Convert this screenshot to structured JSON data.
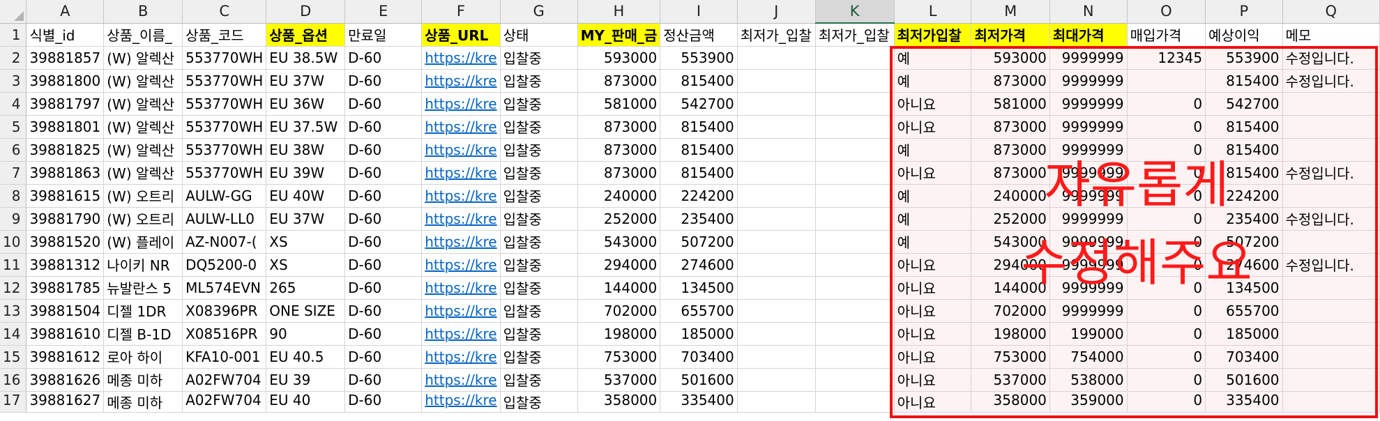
{
  "sheet": {
    "columns": [
      "A",
      "B",
      "C",
      "D",
      "E",
      "F",
      "G",
      "H",
      "I",
      "J",
      "K",
      "L",
      "M",
      "N",
      "O",
      "P",
      "Q"
    ],
    "selected_column": "K",
    "row_numbers": [
      1,
      2,
      3,
      4,
      5,
      6,
      7,
      8,
      9,
      10,
      11,
      12,
      13,
      14,
      15,
      16,
      17
    ],
    "header_row": [
      "식별_id",
      "상품_이름_",
      "상품_코드",
      "상품_옵션",
      "만료일",
      "상품_URL",
      "상태",
      "MY_판매_금",
      "정산금액",
      "최저가_입찰",
      "최저가_입찰",
      "최저가입찰",
      "최저가격",
      "최대가격",
      "매입가격",
      "예상이익",
      "메모"
    ],
    "highlighted_headers": [
      "D",
      "F",
      "H",
      "L",
      "M",
      "N"
    ],
    "rows": [
      [
        "39881857",
        "(W) 알렉산",
        "553770WH",
        "EU 38.5W",
        "D-60",
        "https://kre",
        "입찰중",
        "593000",
        "553900",
        "",
        "",
        "예",
        "593000",
        "9999999",
        "12345",
        "553900",
        "수정입니다."
      ],
      [
        "39881800",
        "(W) 알렉산",
        "553770WH",
        "EU 37W",
        "D-60",
        "https://kre",
        "입찰중",
        "873000",
        "815400",
        "",
        "",
        "예",
        "873000",
        "9999999",
        "",
        "815400",
        "수정입니다."
      ],
      [
        "39881797",
        "(W) 알렉산",
        "553770WH",
        "EU 36W",
        "D-60",
        "https://kre",
        "입찰중",
        "581000",
        "542700",
        "",
        "",
        "아니요",
        "581000",
        "9999999",
        "0",
        "542700",
        ""
      ],
      [
        "39881801",
        "(W) 알렉산",
        "553770WH",
        "EU 37.5W",
        "D-60",
        "https://kre",
        "입찰중",
        "873000",
        "815400",
        "",
        "",
        "아니요",
        "873000",
        "9999999",
        "0",
        "815400",
        ""
      ],
      [
        "39881825",
        "(W) 알렉산",
        "553770WH",
        "EU 38W",
        "D-60",
        "https://kre",
        "입찰중",
        "873000",
        "815400",
        "",
        "",
        "예",
        "873000",
        "9999999",
        "0",
        "815400",
        ""
      ],
      [
        "39881863",
        "(W) 알렉산",
        "553770WH",
        "EU 39W",
        "D-60",
        "https://kre",
        "입찰중",
        "873000",
        "815400",
        "",
        "",
        "아니요",
        "873000",
        "9999999",
        "0",
        "815400",
        "수정입니다."
      ],
      [
        "39881615",
        "(W) 오트리",
        "AULW-GG",
        "EU 40W",
        "D-60",
        "https://kre",
        "입찰중",
        "240000",
        "224200",
        "",
        "",
        "예",
        "240000",
        "9999999",
        "0",
        "224200",
        ""
      ],
      [
        "39881790",
        "(W) 오트리",
        "AULW-LL0",
        "EU 37W",
        "D-60",
        "https://kre",
        "입찰중",
        "252000",
        "235400",
        "",
        "",
        "예",
        "252000",
        "9999999",
        "0",
        "235400",
        "수정입니다."
      ],
      [
        "39881520",
        "(W) 플레이",
        "AZ-N007-(",
        "XS",
        "D-60",
        "https://kre",
        "입찰중",
        "543000",
        "507200",
        "",
        "",
        "예",
        "543000",
        "9999999",
        "0",
        "507200",
        ""
      ],
      [
        "39881312",
        "나이키 NR",
        "DQ5200-0",
        "XS",
        "D-60",
        "https://kre",
        "입찰중",
        "294000",
        "274600",
        "",
        "",
        "아니요",
        "294000",
        "9999999",
        "0",
        "274600",
        "수정입니다."
      ],
      [
        "39881785",
        "뉴발란스 5",
        "ML574EVN",
        "265",
        "D-60",
        "https://kre",
        "입찰중",
        "144000",
        "134500",
        "",
        "",
        "아니요",
        "144000",
        "9999999",
        "0",
        "134500",
        ""
      ],
      [
        "39881504",
        "디젤 1DR",
        "X08396PR",
        "ONE SIZE",
        "D-60",
        "https://kre",
        "입찰중",
        "702000",
        "655700",
        "",
        "",
        "아니요",
        "702000",
        "9999999",
        "0",
        "655700",
        ""
      ],
      [
        "39881610",
        "디젤 B-1D",
        "X08516PR",
        "90",
        "D-60",
        "https://kre",
        "입찰중",
        "198000",
        "185000",
        "",
        "",
        "아니요",
        "198000",
        "199000",
        "0",
        "185000",
        ""
      ],
      [
        "39881612",
        "로아 하이",
        "KFA10-001",
        "EU 40.5",
        "D-60",
        "https://kre",
        "입찰중",
        "753000",
        "703400",
        "",
        "",
        "아니요",
        "753000",
        "754000",
        "0",
        "703400",
        ""
      ],
      [
        "39881626",
        "메종 미하",
        "A02FW704",
        "EU 39",
        "D-60",
        "https://kre",
        "입찰중",
        "537000",
        "501600",
        "",
        "",
        "아니요",
        "537000",
        "538000",
        "0",
        "501600",
        ""
      ],
      [
        "39881627",
        "메종 미하",
        "A02FW704",
        "EU 40",
        "D-60",
        "https://kre",
        "입찰중",
        "358000",
        "335400",
        "",
        "",
        "아니요",
        "358000",
        "359000",
        "0",
        "335400",
        ""
      ]
    ]
  },
  "annotation": {
    "line1": "자유롭게",
    "line2": "수정해주요"
  },
  "colors": {
    "highlight": "#ffff00",
    "annotation_red": "#ff1a1a",
    "link_blue": "#0563c1",
    "excel_green": "#217346"
  }
}
